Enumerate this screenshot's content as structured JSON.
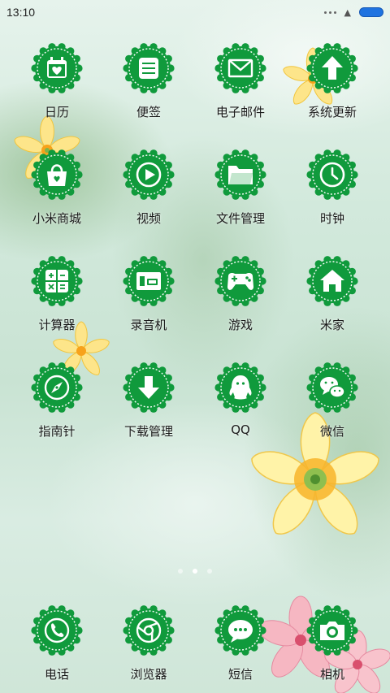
{
  "status_bar": {
    "time": "13:10"
  },
  "apps": [
    [
      {
        "label": "日历",
        "icon": "calendar-icon"
      },
      {
        "label": "便签",
        "icon": "notes-icon"
      },
      {
        "label": "电子邮件",
        "icon": "email-icon"
      },
      {
        "label": "系统更新",
        "icon": "update-arrow-icon"
      }
    ],
    [
      {
        "label": "小米商城",
        "icon": "shopping-bag-icon"
      },
      {
        "label": "视频",
        "icon": "play-icon"
      },
      {
        "label": "文件管理",
        "icon": "folder-icon"
      },
      {
        "label": "时钟",
        "icon": "clock-icon"
      }
    ],
    [
      {
        "label": "计算器",
        "icon": "calculator-icon"
      },
      {
        "label": "录音机",
        "icon": "recorder-icon"
      },
      {
        "label": "游戏",
        "icon": "gamepad-icon"
      },
      {
        "label": "米家",
        "icon": "home-icon"
      }
    ],
    [
      {
        "label": "指南针",
        "icon": "compass-icon"
      },
      {
        "label": "下载管理",
        "icon": "download-icon"
      },
      {
        "label": "QQ",
        "icon": "qq-icon"
      },
      {
        "label": "微信",
        "icon": "wechat-icon"
      }
    ]
  ],
  "dock": [
    {
      "label": "电话",
      "icon": "phone-icon"
    },
    {
      "label": "浏览器",
      "icon": "browser-icon"
    },
    {
      "label": "短信",
      "icon": "message-icon"
    },
    {
      "label": "相机",
      "icon": "camera-icon"
    }
  ],
  "page_indicator": {
    "pages": 3,
    "current": 2
  },
  "theme": {
    "icon_green": "#109a3c",
    "icon_border": "#ffffff"
  }
}
